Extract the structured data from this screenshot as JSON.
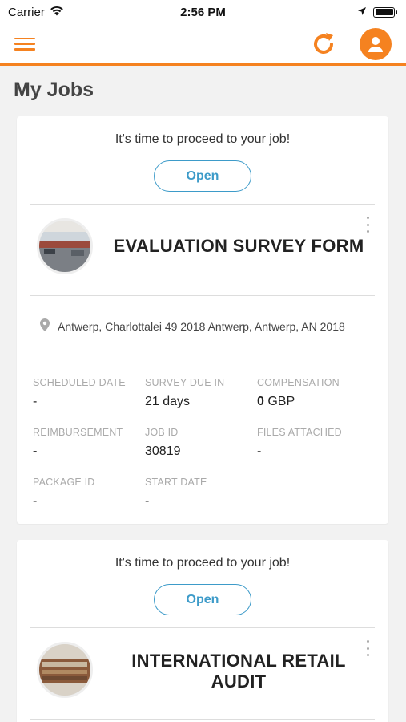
{
  "status_bar": {
    "carrier": "Carrier",
    "time": "2:56 PM"
  },
  "nav": {
    "accent_color": "#f58220",
    "icons": [
      "menu-icon",
      "refresh-icon",
      "profile-icon"
    ]
  },
  "page": {
    "title": "My Jobs"
  },
  "jobs": [
    {
      "proceed_text": "It's time to proceed to your job!",
      "open_label": "Open",
      "title": "EVALUATION SURVEY FORM",
      "address": "Antwerp, Charlottalei 49 2018 Antwerp, Antwerp, AN 2018",
      "details": {
        "scheduled_date_label": "SCHEDULED DATE",
        "scheduled_date_value": "-",
        "survey_due_label": "SURVEY DUE IN",
        "survey_due_value": "21 days",
        "compensation_label": "COMPENSATION",
        "compensation_amount": "0",
        "compensation_currency": "GBP",
        "reimbursement_label": "REIMBURSEMENT",
        "reimbursement_value": "-",
        "job_id_label": "JOB ID",
        "job_id_value": "30819",
        "files_attached_label": "FILES ATTACHED",
        "files_attached_value": "-",
        "package_id_label": "PACKAGE ID",
        "package_id_value": "-",
        "start_date_label": "START DATE",
        "start_date_value": "-"
      }
    },
    {
      "proceed_text": "It's time to proceed to your job!",
      "open_label": "Open",
      "title_line1": "INTERNATIONAL RETAIL",
      "title_line2": "AUDIT"
    }
  ]
}
